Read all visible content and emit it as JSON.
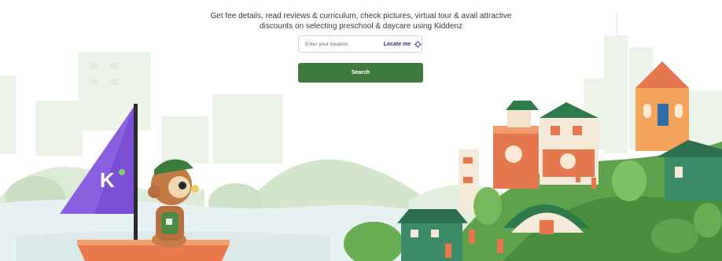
{
  "hero": {
    "line1": "Get fee details, read reviews & curriculum, check pictures, virtual tour & avail attractive",
    "line2": "discounts on selecting preschool & daycare using Kiddenz"
  },
  "location_search": {
    "placeholder": "Enter your location",
    "locate_label": "Locate me"
  },
  "search_button": {
    "label": "Search"
  },
  "illustration": {
    "sail_letter": "K"
  },
  "colors": {
    "primary_green": "#3f7a3d",
    "locate_purple": "#3c2b7a",
    "sail_purple": "#8a5fe0"
  }
}
